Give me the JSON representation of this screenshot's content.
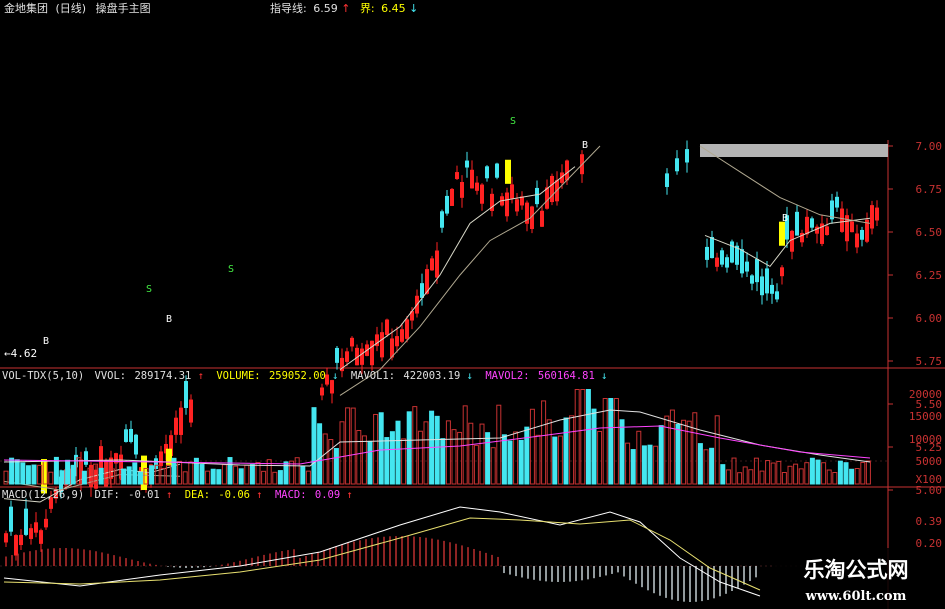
{
  "top_header": {
    "stock": "金地集团",
    "period": "(日线)",
    "indicator": "操盘手主图",
    "guide_label": "指导线:",
    "guide_value": "6.59",
    "bound_label": "界:",
    "bound_value": "6.45"
  },
  "vol_header": {
    "name": "VOL-TDX(5,10)",
    "vvol_label": "VVOL:",
    "vvol_value": "289174.31",
    "volume_label": "VOLUME:",
    "volume_value": "259052.00",
    "mavol1_label": "MAVOL1:",
    "mavol1_value": "422003.19",
    "mavol2_label": "MAVOL2:",
    "mavol2_value": "560164.81"
  },
  "macd_header": {
    "name": "MACD(12,26,9)",
    "dif_label": "DIF:",
    "dif_value": "-0.01",
    "dea_label": "DEA:",
    "dea_value": "-0.06",
    "macd_label": "MACD:",
    "macd_value": "0.09"
  },
  "price_axis": [
    "7.00",
    "6.75",
    "6.50",
    "6.25",
    "6.00",
    "5.75",
    "5.50",
    "5.25",
    "5.00"
  ],
  "volume_axis": [
    "20000",
    "15000",
    "10000",
    "5000",
    "X100"
  ],
  "macd_axis": [
    "0.39",
    "0.20"
  ],
  "chart_labels": {
    "low_price": "←4.62",
    "signals": [
      "B",
      "S",
      "B",
      "S",
      "S",
      "B",
      "B"
    ]
  },
  "watermark": {
    "title": "乐淘公式网",
    "url": "www.60lt.com"
  },
  "colors": {
    "background": "#000000",
    "up": "#ff2222",
    "down": "#44e6f0",
    "signal_box": "#ffff00",
    "axis_red": "#c83232",
    "ma_white": "#d8d8c8",
    "text_yellow": "#ffff00",
    "text_purple": "#ff44ff"
  }
}
